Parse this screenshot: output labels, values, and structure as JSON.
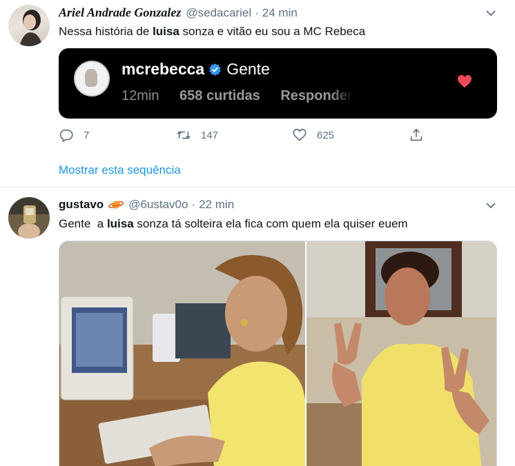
{
  "tweets": [
    {
      "display_name": "Ariel Andrade Gonzalez",
      "handle": "@sedacariel",
      "separator": "·",
      "time": "24 min",
      "text_before": "Nessa história de ",
      "text_highlight": "luisa",
      "text_after": " sonza e vitão eu sou a MC Rebeca",
      "embedded_comment": {
        "username": "mcrebecca",
        "comment": "Gente",
        "time": "12min",
        "likes": "658 curtidas",
        "reply": "Responder"
      },
      "actions": {
        "replies": "7",
        "retweets": "147",
        "likes": "625"
      },
      "show_thread": "Mostrar esta sequência"
    },
    {
      "display_name": "gustavo",
      "handle": "@6ustav0o",
      "separator": "·",
      "time": "22 min",
      "text_before": "Gente  a ",
      "text_highlight": "luisa",
      "text_after": " sonza tá solteira ela fica com quem ela quiser euem"
    }
  ],
  "colors": {
    "link_blue": "#1b95e0",
    "muted_gray": "#5b7083",
    "verified_blue": "#3897f0",
    "heart_red": "#ed4956",
    "card_bg": "#000000"
  }
}
